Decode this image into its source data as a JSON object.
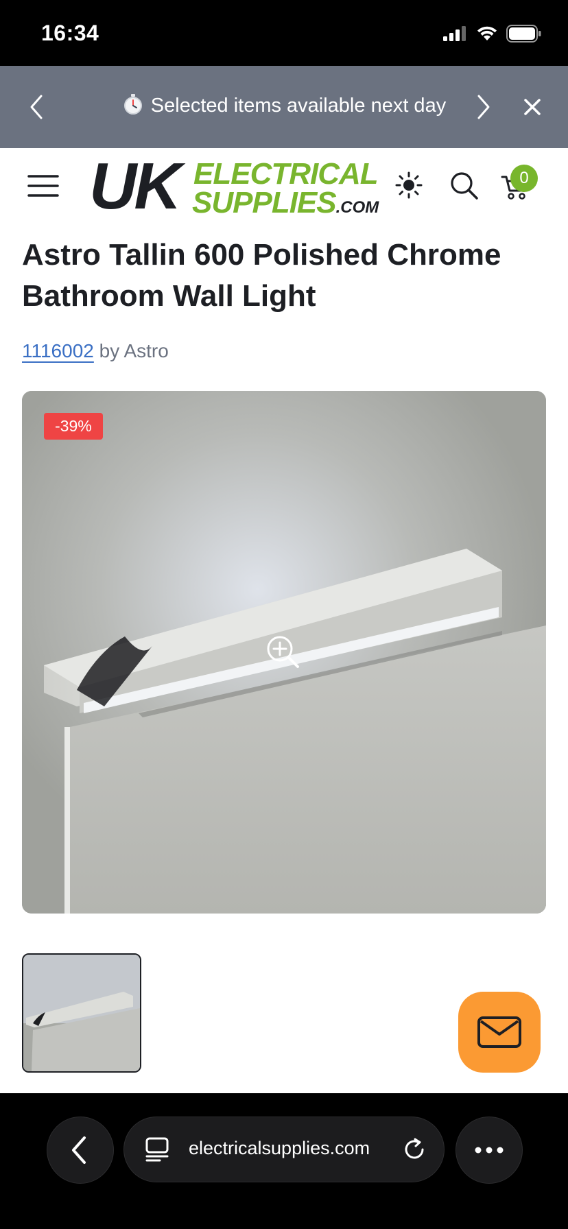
{
  "status_bar": {
    "time": "16:34"
  },
  "announcement": {
    "text": "Selected items available next day"
  },
  "header": {
    "logo": {
      "uk": "UK",
      "line1": "ELECTRICAL",
      "line2": "SUPPLIES",
      "com": ".COM"
    },
    "cart_count": "0"
  },
  "product": {
    "title": "Astro Tallin 600 Polished Chrome Bathroom Wall Light",
    "sku": "1116002",
    "by_brand": "by Astro",
    "discount_badge": "-39%"
  },
  "browser": {
    "url": "electricalsupplies.com"
  },
  "colors": {
    "announcement_bg": "#6b7280",
    "brand_green": "#79b52e",
    "badge_red": "#ef4444",
    "chat_orange": "#fb9a33",
    "link_blue": "#3a6fc4"
  }
}
